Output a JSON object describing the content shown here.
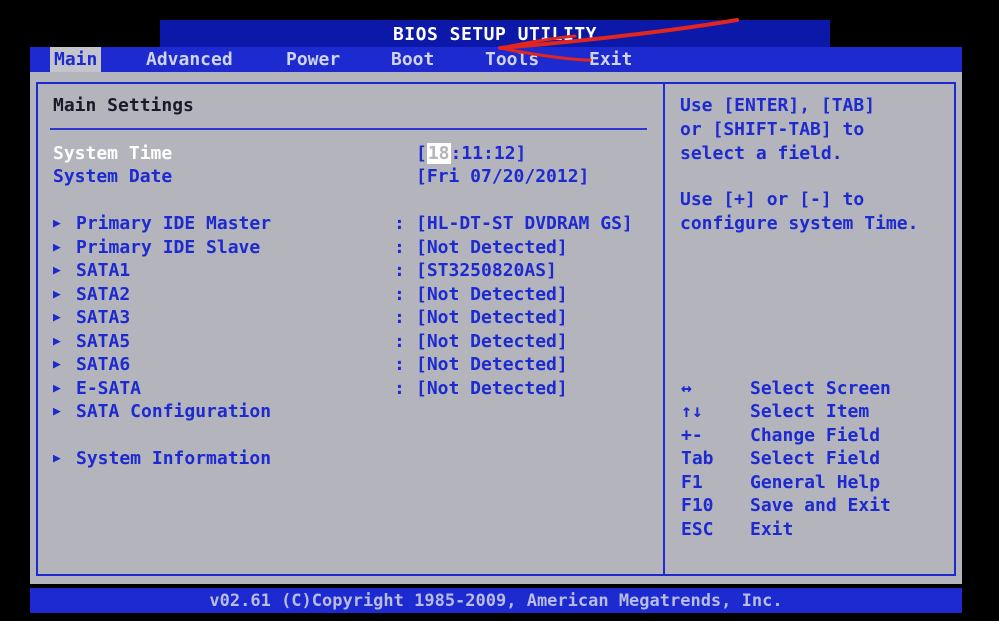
{
  "title": "BIOS SETUP UTILITY",
  "menu": [
    {
      "label": "Main",
      "active": true
    },
    {
      "label": "Advanced",
      "active": false
    },
    {
      "label": "Power",
      "active": false
    },
    {
      "label": "Boot",
      "active": false
    },
    {
      "label": "Tools",
      "active": false
    },
    {
      "label": "Exit",
      "active": false
    }
  ],
  "main": {
    "heading": "Main Settings",
    "system_time": {
      "label": "System Time",
      "open": "[",
      "cursor": "18",
      "rest": ":11:12]"
    },
    "system_date": {
      "label": "System Date",
      "value": "[Fri 07/20/2012]"
    },
    "devices": [
      {
        "label": "Primary IDE Master",
        "sep": ":",
        "value": "[HL-DT-ST DVDRAM GS]"
      },
      {
        "label": "Primary IDE Slave",
        "sep": ":",
        "value": "[Not Detected]"
      },
      {
        "label": "SATA1",
        "sep": ":",
        "value": "[ST3250820AS]"
      },
      {
        "label": "SATA2",
        "sep": ":",
        "value": "[Not Detected]"
      },
      {
        "label": "SATA3",
        "sep": ":",
        "value": "[Not Detected]"
      },
      {
        "label": "SATA5",
        "sep": ":",
        "value": "[Not Detected]"
      },
      {
        "label": "SATA6",
        "sep": ":",
        "value": "[Not Detected]"
      },
      {
        "label": "E-SATA",
        "sep": ":",
        "value": "[Not Detected]"
      }
    ],
    "sata_configuration": "SATA Configuration",
    "system_information": "System Information",
    "submenu_glyph": "▶"
  },
  "help": {
    "lines": [
      "Use [ENTER], [TAB]",
      "or [SHIFT-TAB] to",
      "select a field.",
      "",
      "Use [+] or [-] to",
      "configure system Time."
    ],
    "keys": [
      {
        "key": "↔",
        "desc": "Select Screen"
      },
      {
        "key": "↑↓",
        "desc": "Select Item"
      },
      {
        "key": "+-",
        "desc": "Change Field"
      },
      {
        "key": "Tab",
        "desc": "Select Field"
      },
      {
        "key": "F1",
        "desc": "General Help"
      },
      {
        "key": "F10",
        "desc": "Save and Exit"
      },
      {
        "key": "ESC",
        "desc": "Exit"
      }
    ]
  },
  "footer": "v02.61 (C)Copyright 1985-2009, American Megatrends, Inc.",
  "colors": {
    "menu_bar": "#1c2ad0",
    "panel": "#b4b4bc",
    "annotation": "#e0261e"
  }
}
